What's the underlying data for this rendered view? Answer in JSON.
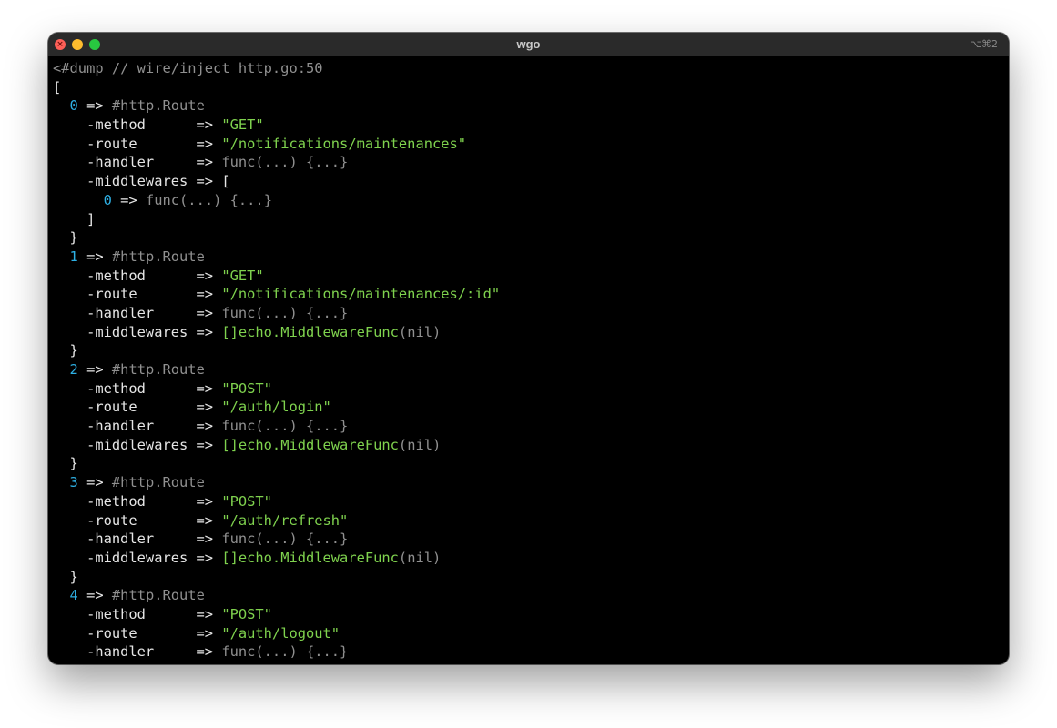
{
  "window": {
    "title": "wgo",
    "shortcut": "⌥⌘2",
    "close_glyph": "×"
  },
  "colors": {
    "background": "#000000",
    "text": "#e6e6e6",
    "muted": "#909090",
    "index": "#2eb0e4",
    "string": "#7fd24e"
  },
  "terminal": {
    "lines": [
      [
        {
          "t": "<#dump // wire/inject_http.go:50",
          "c": "gray"
        }
      ],
      [
        {
          "t": "[",
          "c": "white"
        }
      ],
      [
        {
          "t": "  ",
          "c": "white"
        },
        {
          "t": "0",
          "c": "num"
        },
        {
          "t": " => ",
          "c": "white"
        },
        {
          "t": "#http.Route",
          "c": "gray"
        }
      ],
      [
        {
          "t": "    -method      => ",
          "c": "white"
        },
        {
          "t": "\"GET\"",
          "c": "str"
        }
      ],
      [
        {
          "t": "    -route       => ",
          "c": "white"
        },
        {
          "t": "\"/notifications/maintenances\"",
          "c": "str"
        }
      ],
      [
        {
          "t": "    -handler     => ",
          "c": "white"
        },
        {
          "t": "func(...) {...}",
          "c": "gray"
        }
      ],
      [
        {
          "t": "    -middlewares => [",
          "c": "white"
        }
      ],
      [
        {
          "t": "      ",
          "c": "white"
        },
        {
          "t": "0",
          "c": "num"
        },
        {
          "t": " => ",
          "c": "white"
        },
        {
          "t": "func(...) {...}",
          "c": "gray"
        }
      ],
      [
        {
          "t": "    ]",
          "c": "white"
        }
      ],
      [
        {
          "t": "  }",
          "c": "white"
        }
      ],
      [
        {
          "t": "  ",
          "c": "white"
        },
        {
          "t": "1",
          "c": "num"
        },
        {
          "t": " => ",
          "c": "white"
        },
        {
          "t": "#http.Route",
          "c": "gray"
        }
      ],
      [
        {
          "t": "    -method      => ",
          "c": "white"
        },
        {
          "t": "\"GET\"",
          "c": "str"
        }
      ],
      [
        {
          "t": "    -route       => ",
          "c": "white"
        },
        {
          "t": "\"/notifications/maintenances/:id\"",
          "c": "str"
        }
      ],
      [
        {
          "t": "    -handler     => ",
          "c": "white"
        },
        {
          "t": "func(...) {...}",
          "c": "gray"
        }
      ],
      [
        {
          "t": "    -middlewares => ",
          "c": "white"
        },
        {
          "t": "[]echo.MiddlewareFunc",
          "c": "str"
        },
        {
          "t": "(nil)",
          "c": "gray"
        }
      ],
      [
        {
          "t": "  }",
          "c": "white"
        }
      ],
      [
        {
          "t": "  ",
          "c": "white"
        },
        {
          "t": "2",
          "c": "num"
        },
        {
          "t": " => ",
          "c": "white"
        },
        {
          "t": "#http.Route",
          "c": "gray"
        }
      ],
      [
        {
          "t": "    -method      => ",
          "c": "white"
        },
        {
          "t": "\"POST\"",
          "c": "str"
        }
      ],
      [
        {
          "t": "    -route       => ",
          "c": "white"
        },
        {
          "t": "\"/auth/login\"",
          "c": "str"
        }
      ],
      [
        {
          "t": "    -handler     => ",
          "c": "white"
        },
        {
          "t": "func(...) {...}",
          "c": "gray"
        }
      ],
      [
        {
          "t": "    -middlewares => ",
          "c": "white"
        },
        {
          "t": "[]echo.MiddlewareFunc",
          "c": "str"
        },
        {
          "t": "(nil)",
          "c": "gray"
        }
      ],
      [
        {
          "t": "  }",
          "c": "white"
        }
      ],
      [
        {
          "t": "  ",
          "c": "white"
        },
        {
          "t": "3",
          "c": "num"
        },
        {
          "t": " => ",
          "c": "white"
        },
        {
          "t": "#http.Route",
          "c": "gray"
        }
      ],
      [
        {
          "t": "    -method      => ",
          "c": "white"
        },
        {
          "t": "\"POST\"",
          "c": "str"
        }
      ],
      [
        {
          "t": "    -route       => ",
          "c": "white"
        },
        {
          "t": "\"/auth/refresh\"",
          "c": "str"
        }
      ],
      [
        {
          "t": "    -handler     => ",
          "c": "white"
        },
        {
          "t": "func(...) {...}",
          "c": "gray"
        }
      ],
      [
        {
          "t": "    -middlewares => ",
          "c": "white"
        },
        {
          "t": "[]echo.MiddlewareFunc",
          "c": "str"
        },
        {
          "t": "(nil)",
          "c": "gray"
        }
      ],
      [
        {
          "t": "  }",
          "c": "white"
        }
      ],
      [
        {
          "t": "  ",
          "c": "white"
        },
        {
          "t": "4",
          "c": "num"
        },
        {
          "t": " => ",
          "c": "white"
        },
        {
          "t": "#http.Route",
          "c": "gray"
        }
      ],
      [
        {
          "t": "    -method      => ",
          "c": "white"
        },
        {
          "t": "\"POST\"",
          "c": "str"
        }
      ],
      [
        {
          "t": "    -route       => ",
          "c": "white"
        },
        {
          "t": "\"/auth/logout\"",
          "c": "str"
        }
      ],
      [
        {
          "t": "    -handler     => ",
          "c": "white"
        },
        {
          "t": "func(...) {...}",
          "c": "gray"
        }
      ]
    ]
  }
}
